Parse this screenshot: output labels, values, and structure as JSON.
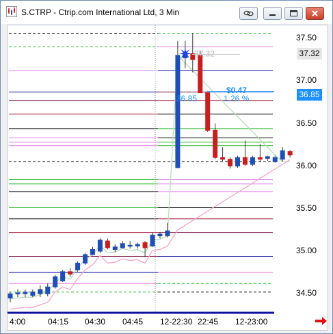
{
  "window": {
    "title": "S.CTRP - Ctrip.com International Ltd, 3 Min",
    "icon": "chart-app-icon",
    "buttons": [
      "link-icon",
      "minimize-icon",
      "maximize-icon",
      "close-icon"
    ]
  },
  "chart": {
    "y_ticks": [
      "37.50",
      "37.00",
      "36.50",
      "36.00",
      "35.50",
      "35.00",
      "34.50"
    ],
    "x_ticks": [
      "4:00",
      "04:15",
      "04:30",
      "04:45",
      "12-22:30",
      "22:45",
      "12-23:00"
    ],
    "last_price_label": "37.32",
    "second_price_label": "36.85",
    "annotation_high": "37.32",
    "annotation_change": "$0.47",
    "annotation_price": "36.85",
    "annotation_percent": "1.26 %",
    "colors": {
      "up_candle": "#1f4fb5",
      "down_candle": "#c81e1e",
      "annotation": "#1e90ff",
      "last_price_bg": "#e6e6e6",
      "second_price_bg": "#1e90ff"
    }
  },
  "chart_data": {
    "type": "candlestick",
    "x_labels": [
      "4:00",
      "04:15",
      "04:30",
      "04:45",
      "12-22:30",
      "22:45",
      "12-23:00"
    ],
    "ylim": [
      34.4,
      37.7
    ],
    "candles": [
      {
        "o": 34.45,
        "h": 34.52,
        "l": 34.4,
        "c": 34.5
      },
      {
        "o": 34.5,
        "h": 34.55,
        "l": 34.46,
        "c": 34.51
      },
      {
        "o": 34.5,
        "h": 34.55,
        "l": 34.46,
        "c": 34.52
      },
      {
        "o": 34.48,
        "h": 34.55,
        "l": 34.46,
        "c": 34.52
      },
      {
        "o": 34.5,
        "h": 34.6,
        "l": 34.46,
        "c": 34.55
      },
      {
        "o": 34.5,
        "h": 34.62,
        "l": 34.47,
        "c": 34.58
      },
      {
        "o": 34.58,
        "h": 34.72,
        "l": 34.56,
        "c": 34.7
      },
      {
        "o": 34.65,
        "h": 34.78,
        "l": 34.64,
        "c": 34.76
      },
      {
        "o": 34.76,
        "h": 34.8,
        "l": 34.7,
        "c": 34.73
      },
      {
        "o": 34.78,
        "h": 34.88,
        "l": 34.76,
        "c": 34.86
      },
      {
        "o": 34.86,
        "h": 34.98,
        "l": 34.84,
        "c": 34.96
      },
      {
        "o": 34.96,
        "h": 35.05,
        "l": 34.95,
        "c": 35.02
      },
      {
        "o": 35.0,
        "h": 35.15,
        "l": 34.98,
        "c": 35.13
      },
      {
        "o": 35.12,
        "h": 35.15,
        "l": 35.02,
        "c": 35.04
      },
      {
        "o": 35.02,
        "h": 35.08,
        "l": 34.99,
        "c": 35.05
      },
      {
        "o": 35.04,
        "h": 35.12,
        "l": 35.03,
        "c": 35.09
      },
      {
        "o": 35.06,
        "h": 35.12,
        "l": 35.03,
        "c": 35.07
      },
      {
        "o": 35.06,
        "h": 35.1,
        "l": 35.03,
        "c": 35.08
      },
      {
        "o": 35.1,
        "h": 35.12,
        "l": 34.93,
        "c": 35.04
      },
      {
        "o": 35.06,
        "h": 35.22,
        "l": 35.05,
        "c": 35.19
      },
      {
        "o": 35.18,
        "h": 35.22,
        "l": 35.15,
        "c": 35.2
      },
      {
        "o": 35.18,
        "h": 35.33,
        "l": 35.16,
        "c": 35.24
      },
      {
        "o": 35.98,
        "h": 37.47,
        "l": 35.98,
        "c": 37.3
      },
      {
        "o": 37.27,
        "h": 37.47,
        "l": 37.15,
        "c": 37.32
      },
      {
        "o": 37.32,
        "h": 37.56,
        "l": 37.1,
        "c": 37.25
      },
      {
        "o": 37.3,
        "h": 37.35,
        "l": 36.86,
        "c": 36.86
      },
      {
        "o": 36.86,
        "h": 36.86,
        "l": 36.4,
        "c": 36.42
      },
      {
        "o": 36.42,
        "h": 36.5,
        "l": 36.08,
        "c": 36.1
      },
      {
        "o": 36.1,
        "h": 36.22,
        "l": 36.06,
        "c": 36.08
      },
      {
        "o": 36.08,
        "h": 36.1,
        "l": 35.97,
        "c": 36.0
      },
      {
        "o": 36.0,
        "h": 36.12,
        "l": 35.98,
        "c": 36.1
      },
      {
        "o": 36.1,
        "h": 36.3,
        "l": 36.0,
        "c": 36.02
      },
      {
        "o": 36.02,
        "h": 36.12,
        "l": 36.0,
        "c": 36.1
      },
      {
        "o": 36.1,
        "h": 36.26,
        "l": 36.05,
        "c": 36.08
      },
      {
        "o": 36.09,
        "h": 36.12,
        "l": 36.06,
        "c": 36.11
      },
      {
        "o": 36.05,
        "h": 36.12,
        "l": 36.04,
        "c": 36.1
      },
      {
        "o": 36.08,
        "h": 36.22,
        "l": 36.05,
        "c": 36.18
      },
      {
        "o": 36.17,
        "h": 36.19,
        "l": 36.1,
        "c": 36.13
      }
    ],
    "levels": [
      {
        "price": 37.56,
        "color": "#22b422",
        "style": "dashed"
      },
      {
        "price": 37.4,
        "color": "#e07be0",
        "style": "solid"
      },
      {
        "price": 37.12,
        "color": "#1010a0",
        "style": "solid"
      },
      {
        "price": 36.87,
        "color": "#7a0a3e",
        "style": "solid"
      },
      {
        "price": 36.77,
        "color": "#a01030",
        "style": "solid"
      },
      {
        "price": 36.61,
        "color": "#000000",
        "style": "solid"
      },
      {
        "price": 36.44,
        "color": "#22b422",
        "style": "solid"
      },
      {
        "price": 36.33,
        "color": "#000000",
        "style": "solid"
      },
      {
        "price": 36.28,
        "color": "#22b422",
        "style": "solid"
      },
      {
        "price": 36.24,
        "color": "#22b422",
        "style": "solid"
      },
      {
        "price": 36.05,
        "color": "#000000",
        "style": "dashed"
      },
      {
        "price": 35.84,
        "color": "#e07be0",
        "style": "solid"
      },
      {
        "price": 35.79,
        "color": "#e07be0",
        "style": "solid"
      },
      {
        "price": 35.7,
        "color": "#e07be0",
        "style": "solid"
      },
      {
        "price": 35.51,
        "color": "#000000",
        "style": "solid"
      },
      {
        "price": 35.38,
        "color": "#a01030",
        "style": "solid"
      },
      {
        "price": 35.22,
        "color": "#7a0a3e",
        "style": "solid"
      },
      {
        "price": 34.94,
        "color": "#1010a0",
        "style": "solid"
      },
      {
        "price": 34.75,
        "color": "#e07be0",
        "style": "solid"
      },
      {
        "price": 34.62,
        "color": "#22b422",
        "style": "dashed"
      },
      {
        "price": 34.52,
        "color": "#000000",
        "style": "dashed"
      }
    ]
  }
}
